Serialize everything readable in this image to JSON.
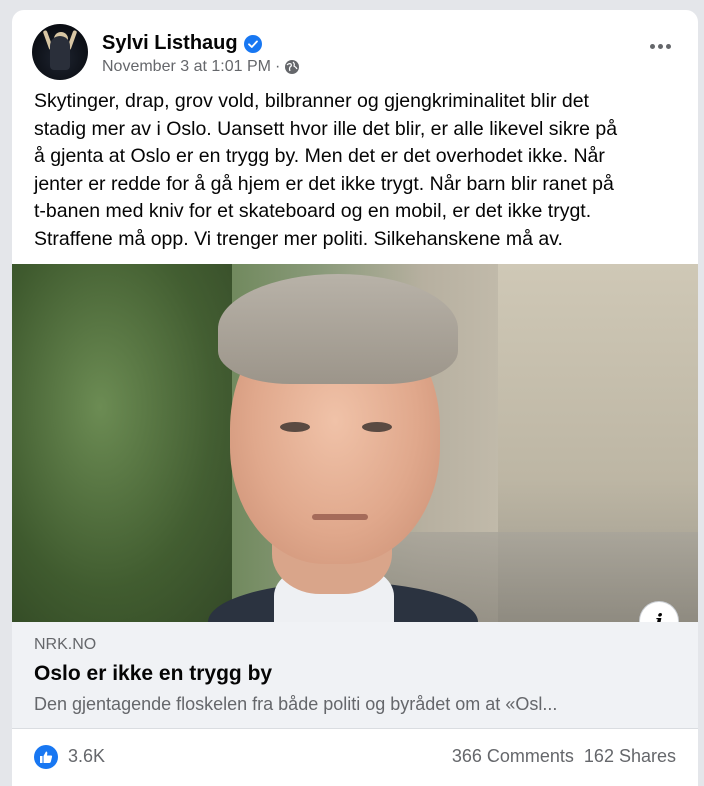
{
  "post": {
    "author": "Sylvi Listhaug",
    "verified_icon": "verified-badge-icon",
    "timestamp": "November 3 at 1:01 PM",
    "separator": "·",
    "privacy_icon": "globe-icon",
    "text_lines": [
      "Skytinger, drap, grov vold, bilbranner og gjengkriminalitet blir det",
      "stadig mer av i Oslo. Uansett hvor ille det blir, er alle likevel sikre på",
      "å gjenta at Oslo er en trygg by. Men det er det overhodet ikke. Når",
      "jenter er redde for å gå hjem er det ikke trygt. Når barn blir ranet på",
      "t-banen med kniv for et skateboard og en mobil, er det ikke trygt.",
      "Straffene må opp. Vi trenger mer politi. Silkehanskene må av."
    ]
  },
  "link": {
    "domain": "NRK.NO",
    "title": "Oslo er ikke en trygg by",
    "description": "Den gjentagende floskelen fra både politi og byrådet om at «Osl...",
    "info_label": "i"
  },
  "stats": {
    "likes": "3.6K",
    "comments": "366 Comments",
    "shares": "162 Shares"
  },
  "colors": {
    "accent": "#1877f2",
    "secondary_text": "#65676b"
  }
}
